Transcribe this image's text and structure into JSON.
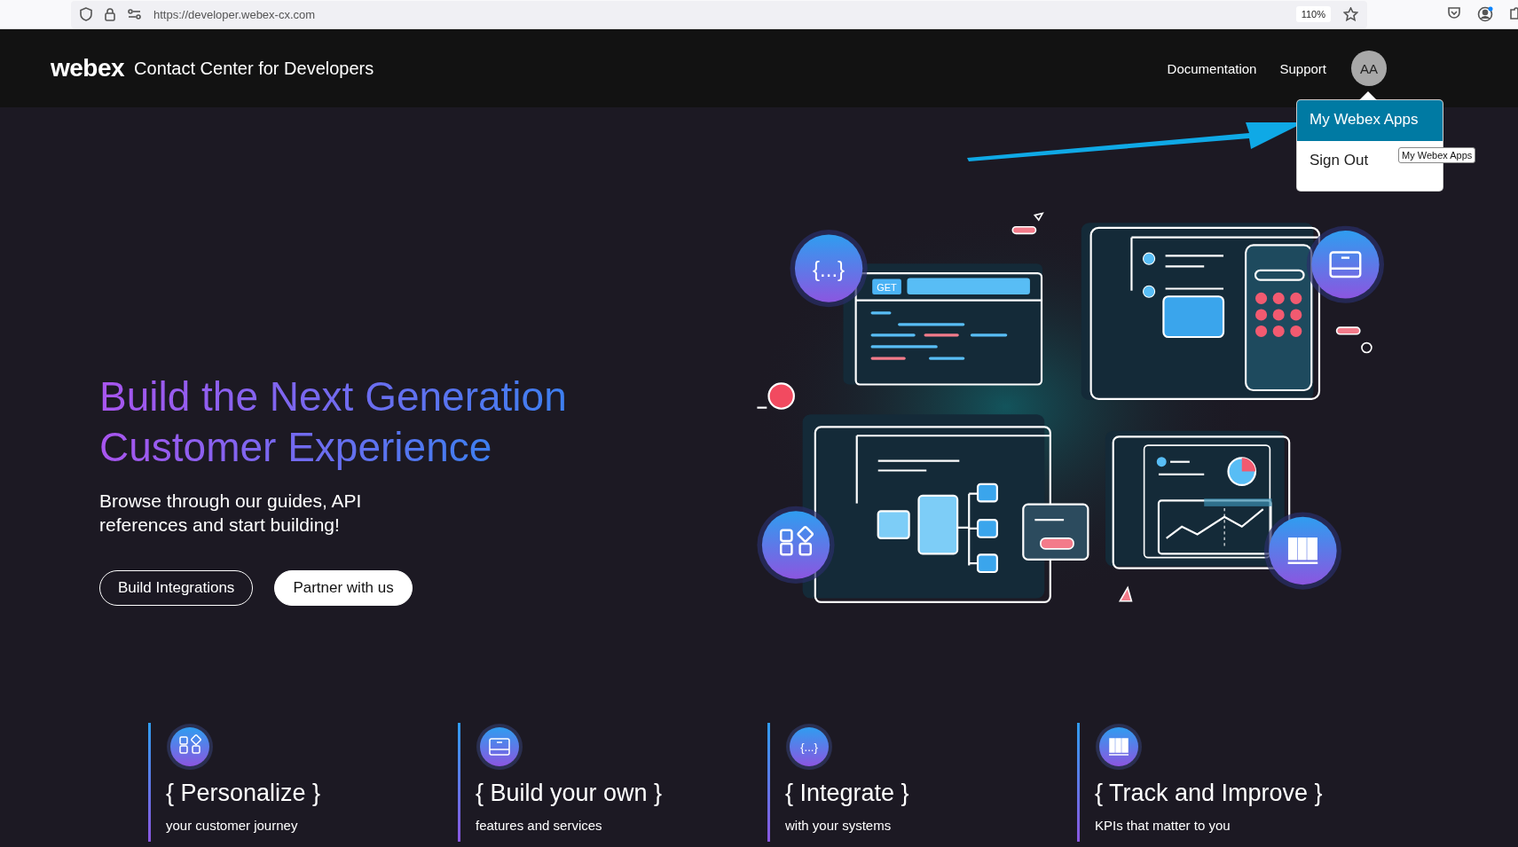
{
  "browser": {
    "url": "https://developer.webex-cx.com",
    "zoom": "110%"
  },
  "header": {
    "logo": "webex",
    "title": "Contact Center for Developers",
    "nav": [
      {
        "label": "Documentation"
      },
      {
        "label": "Support"
      }
    ],
    "avatar": "AA",
    "menu": {
      "expanded": true,
      "items": [
        {
          "label": "My Webex Apps",
          "selected": true
        },
        {
          "label": "Sign Out",
          "selected": false
        }
      ]
    },
    "tooltip": "My Webex Apps"
  },
  "hero": {
    "heading_lines": [
      "Build the Next Generation",
      "Customer Experience"
    ],
    "subtitle": "Browse through our guides, API references and start building!",
    "buttons": [
      {
        "label": "Build Integrations",
        "kind": "outline"
      },
      {
        "label": "Partner with us",
        "kind": "filled"
      }
    ]
  },
  "illustration": {
    "method_label": "GET",
    "badge_text": "{...}"
  },
  "features": [
    {
      "kind": "grid",
      "title": "{ Personalize }",
      "subtitle": "your customer journey"
    },
    {
      "kind": "panel",
      "title": "{ Build your own }",
      "subtitle": "features and services"
    },
    {
      "kind": "braces",
      "icon_text": "{...}",
      "title": "{ Integrate }",
      "subtitle": "with your systems"
    },
    {
      "kind": "bars",
      "title": "{ Track and Improve }",
      "subtitle": "KPIs that matter to you"
    }
  ]
}
